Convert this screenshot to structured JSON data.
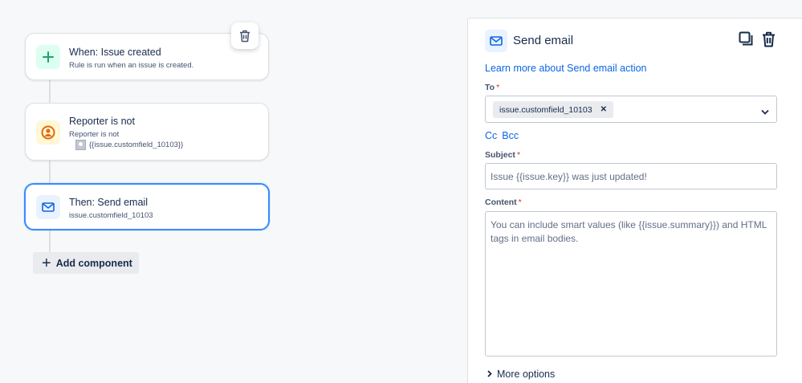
{
  "flow": {
    "trigger": {
      "title": "When: Issue created",
      "subtitle": "Rule is run when an issue is created."
    },
    "condition": {
      "title": "Reporter is not",
      "subtitle": "Reporter is not",
      "value": "{{issue.customfield_10103}}"
    },
    "action": {
      "title": "Then: Send email",
      "subtitle": "issue.customfield_10103"
    },
    "add_component_label": "Add component"
  },
  "panel": {
    "title": "Send email",
    "learn_more": "Learn more about Send email action",
    "to": {
      "label": "To",
      "required": "*",
      "chips": [
        "issue.customfield_10103"
      ]
    },
    "cc_label": "Cc",
    "bcc_label": "Bcc",
    "subject": {
      "label": "Subject",
      "required": "*",
      "value": "Issue {{issue.key}} was just updated!"
    },
    "content": {
      "label": "Content",
      "required": "*",
      "value": "You can include smart values (like {{issue.summary}}) and HTML tags in email bodies."
    },
    "more_options": "More options"
  },
  "colors": {
    "accent_blue": "#388bff",
    "link_blue": "#0c66e4",
    "trigger_green": "#22a06b",
    "condition_orange": "#e56910",
    "required_red": "#c9372c"
  },
  "icons": [
    "plus-icon",
    "user-circle-icon",
    "mail-icon",
    "trash-icon",
    "duplicate-icon",
    "chevron-down-icon",
    "chevron-right-icon",
    "remove-chip-icon"
  ]
}
